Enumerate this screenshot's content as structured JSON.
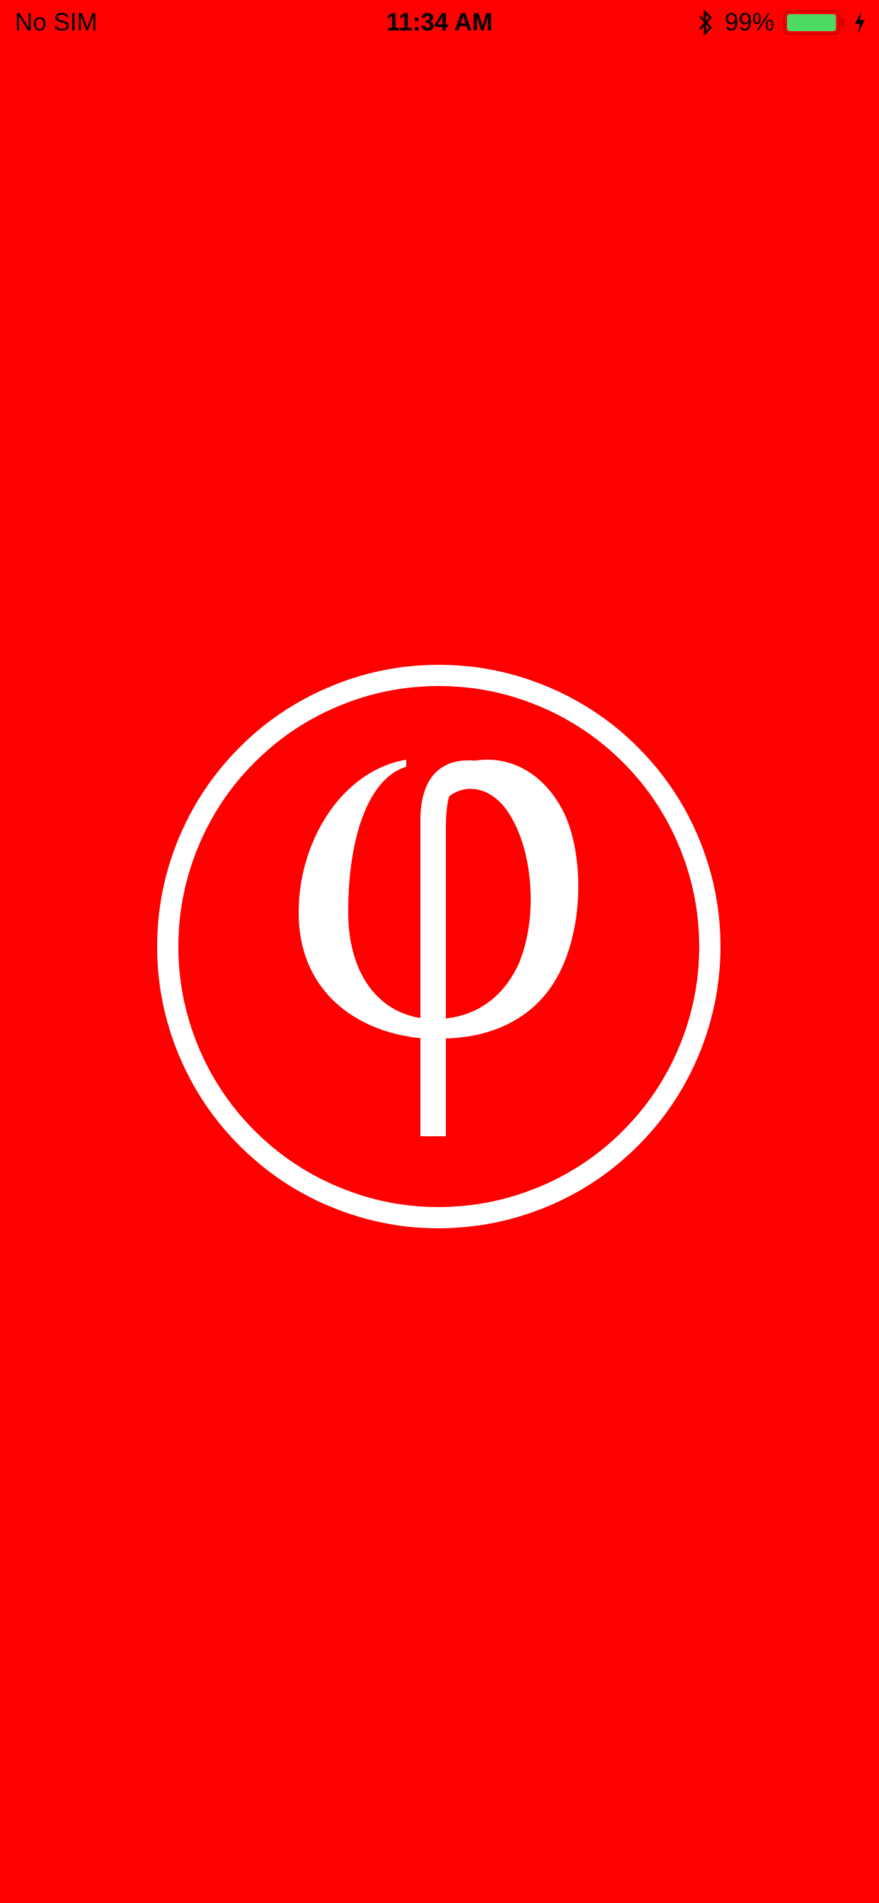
{
  "status_bar": {
    "carrier": "No SIM",
    "time": "11:34 AM",
    "battery_percent": "99%",
    "battery_level": 0.99,
    "battery_fill_color": "#4CD964",
    "battery_outline_color": "#CC0000",
    "icons": [
      "bluetooth-icon",
      "battery-icon",
      "charging-icon"
    ]
  },
  "splash": {
    "background_color": "#FF0000",
    "logo_color": "#FFFFFF",
    "logo_icon": "phi-circle-logo"
  }
}
